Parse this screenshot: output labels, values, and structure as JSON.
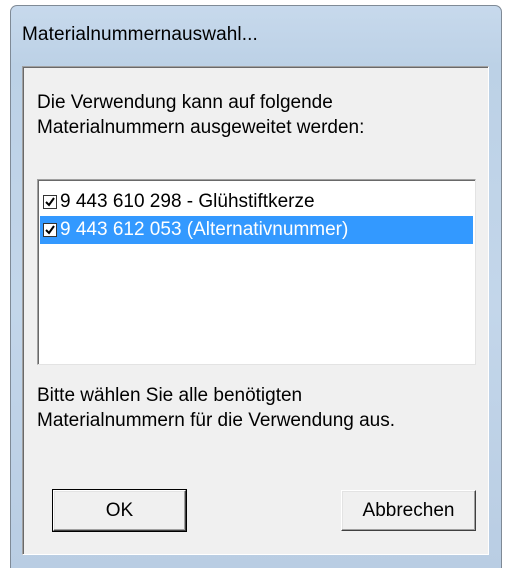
{
  "window": {
    "title": "Materialnummernauswahl..."
  },
  "dialog": {
    "prompt_line1": "Die Verwendung kann auf folgende",
    "prompt_line2": "Materialnummern ausgeweitet werden:",
    "list_items": [
      {
        "label": "9 443 610 298 - Glühstiftkerze",
        "checked": true,
        "selected": false
      },
      {
        "label": "9 443 612 053 (Alternativnummer)",
        "checked": true,
        "selected": true
      }
    ],
    "hint_line1": "Bitte wählen Sie alle benötigten",
    "hint_line2": "Materialnummern für die Verwendung aus.",
    "ok_label": "OK",
    "cancel_label": "Abbrechen"
  },
  "colors": {
    "selection": "#3399ff",
    "title_bar": "#bcd1e6",
    "client": "#f0f0f0"
  }
}
